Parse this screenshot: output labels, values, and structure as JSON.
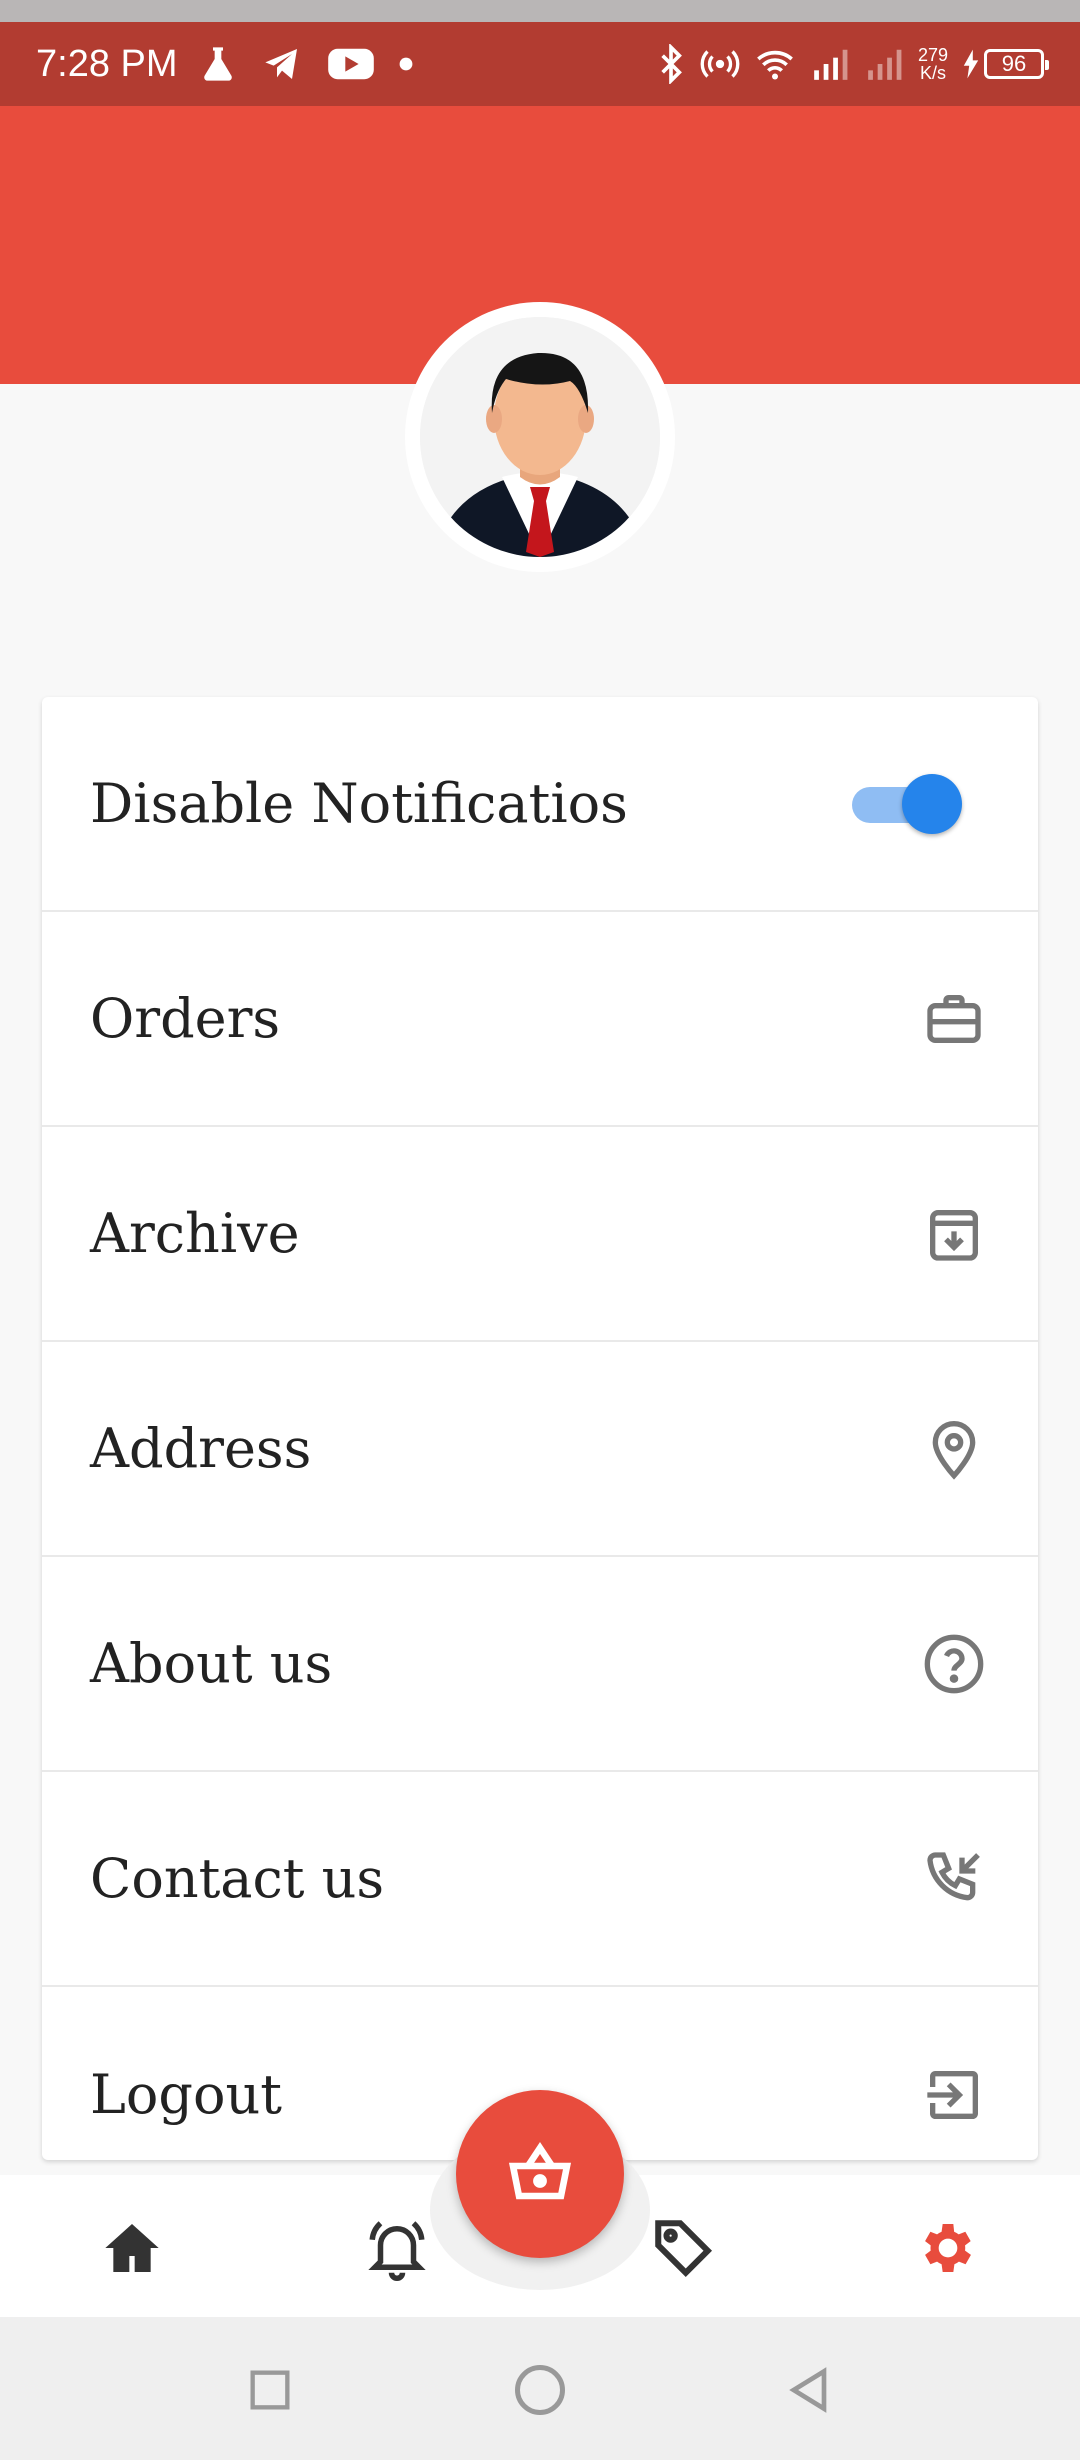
{
  "status_bar": {
    "time": "7:28 PM",
    "net_speed_value": "279",
    "net_speed_unit": "K/s",
    "battery": "96",
    "icons": [
      "flask-icon",
      "telegram-icon",
      "youtube-icon",
      "dot-icon",
      "bluetooth-icon",
      "hotspot-icon",
      "wifi-icon",
      "signal-icon",
      "signal-icon-2",
      "charging-icon"
    ]
  },
  "colors": {
    "accent": "#e84c3d",
    "status_bar": "#b23c31",
    "toggle_on": "#2584eb",
    "icon_gray": "#777777",
    "nav_active": "#e84c3d"
  },
  "profile": {
    "avatar_icon": "user-avatar"
  },
  "settings": {
    "items": [
      {
        "label": "Disable Notificatios",
        "control": "toggle",
        "toggle_on": true
      },
      {
        "label": "Orders",
        "icon": "briefcase-icon"
      },
      {
        "label": "Archive",
        "icon": "archive-icon"
      },
      {
        "label": "Address",
        "icon": "location-pin-icon"
      },
      {
        "label": "About us",
        "icon": "help-circle-icon"
      },
      {
        "label": "Contact us",
        "icon": "phone-callback-icon"
      },
      {
        "label": "Logout",
        "icon": "logout-icon"
      }
    ]
  },
  "bottom_nav": {
    "items": [
      {
        "icon": "home-icon",
        "active": false
      },
      {
        "icon": "bell-alert-icon",
        "active": false
      },
      {
        "icon": "tag-icon",
        "active": false
      },
      {
        "icon": "gear-icon",
        "active": true
      }
    ],
    "fab_icon": "basket-icon"
  },
  "system_nav": [
    "recents-icon",
    "home-circle-icon",
    "back-icon"
  ]
}
